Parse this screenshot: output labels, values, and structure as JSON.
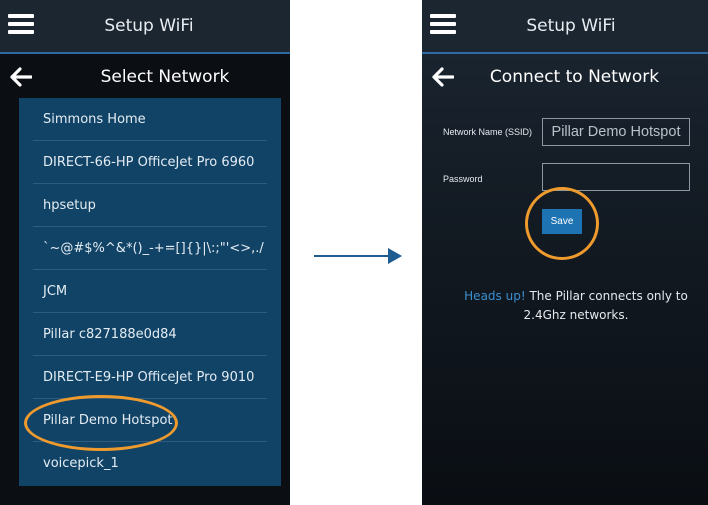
{
  "left_screen": {
    "title": "Setup WiFi",
    "subtitle": "Select Network",
    "networks": [
      "Simmons Home",
      "DIRECT-66-HP OfficeJet Pro 6960",
      "hpsetup",
      "`~@#$%^&*()_-+=[]{}|\\:;\"'<>,./",
      "JCM",
      "Pillar c827188e0d84",
      "DIRECT-E9-HP OfficeJet Pro 9010",
      "Pillar Demo Hotspot",
      "voicepick_1"
    ],
    "selected_network": "Pillar Demo Hotspot"
  },
  "right_screen": {
    "title": "Setup WiFi",
    "subtitle": "Connect to Network",
    "ssid_label": "Network Name (SSID)",
    "ssid_value": "Pillar Demo Hotspot",
    "password_label": "Password",
    "password_value": "",
    "save_label": "Save",
    "note_strong": "Heads up!",
    "note_text": "The Pillar connects only to 2.4Ghz networks."
  },
  "icons": {
    "menu": "hamburger-menu-icon",
    "back": "back-arrow-icon",
    "transition": "right-arrow-icon"
  },
  "colors": {
    "list_background": "#114366",
    "highlight": "#ee9a2d",
    "accent": "#1e73b3",
    "note_accent": "#3a8fcf"
  }
}
